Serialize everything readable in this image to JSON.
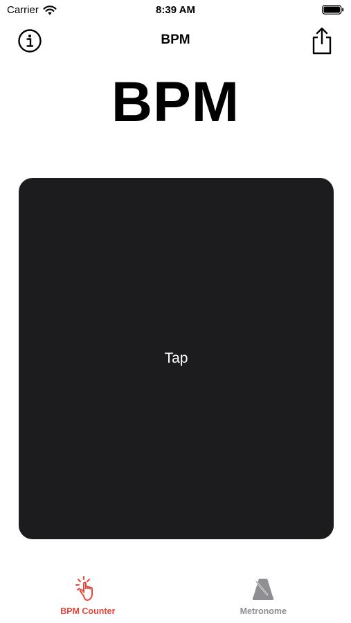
{
  "status_bar": {
    "carrier": "Carrier",
    "time": "8:39 AM",
    "wifi_icon": "wifi-icon",
    "battery_icon": "battery-icon"
  },
  "nav": {
    "title": "BPM",
    "info_icon": "info-icon",
    "share_icon": "share-icon"
  },
  "main": {
    "bpm_value": "BPM",
    "tap_label": "Tap"
  },
  "tabs": [
    {
      "label": "BPM Counter",
      "icon": "tap-hand-icon",
      "active": true
    },
    {
      "label": "Metronome",
      "icon": "metronome-icon",
      "active": false
    }
  ],
  "colors": {
    "accent": "#e8463a",
    "inactive": "#8e8e93",
    "pad": "#1c1c1e"
  }
}
